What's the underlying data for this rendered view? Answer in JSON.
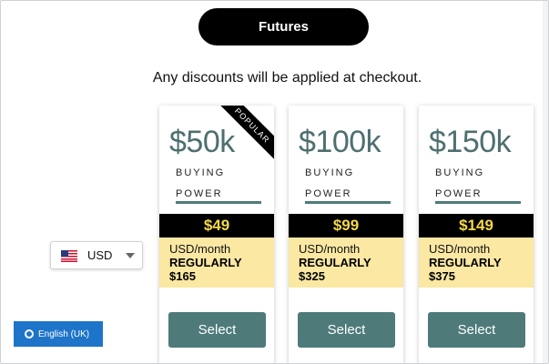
{
  "tabs": {
    "active_label": "Futures"
  },
  "notice": {
    "text": "Any discounts will be applied at checkout."
  },
  "currency": {
    "selected": "USD",
    "flag": "us-flag-icon"
  },
  "language": {
    "label": "English (UK)",
    "icon": "globe-icon"
  },
  "plans": [
    {
      "amount": "$50k",
      "buying": "BUYING",
      "power": "POWER",
      "price": "$49",
      "per_month": "USD/month",
      "regularly": "REGULARLY",
      "regular_price": "$165",
      "badge": "POPULAR",
      "select_label": "Select"
    },
    {
      "amount": "$100k",
      "buying": "BUYING",
      "power": "POWER",
      "price": "$99",
      "per_month": "USD/month",
      "regularly": "REGULARLY",
      "regular_price": "$325",
      "select_label": "Select"
    },
    {
      "amount": "$150k",
      "buying": "BUYING",
      "power": "POWER",
      "price": "$149",
      "per_month": "USD/month",
      "regularly": "REGULARLY",
      "regular_price": "$375",
      "select_label": "Select"
    }
  ],
  "colors": {
    "accent_teal": "#4e7a7a",
    "price_yellow": "#f5d84a",
    "promo_bg": "#fae8a3",
    "lang_blue": "#1e74c9"
  }
}
